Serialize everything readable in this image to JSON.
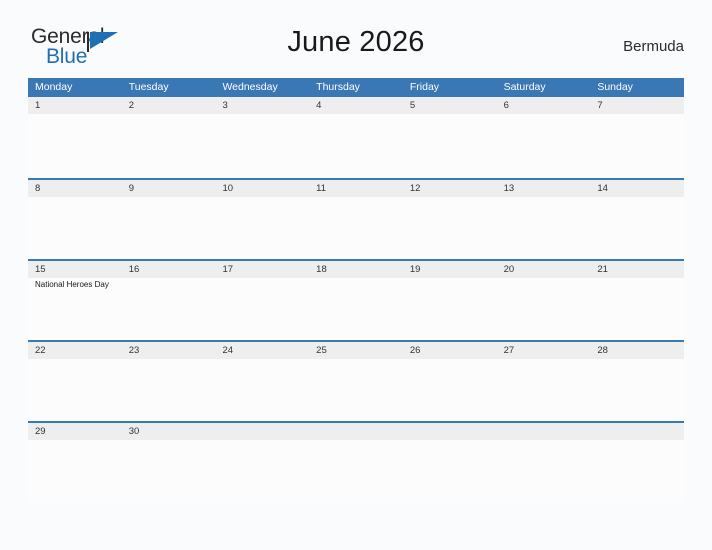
{
  "brand": {
    "name_part1": "General",
    "name_part2": "Blue",
    "flag_icon": "flag-icon",
    "color_primary": "#1f6fb5",
    "color_text": "#2b2b2b"
  },
  "header": {
    "title": "June 2026",
    "country": "Bermuda"
  },
  "theme": {
    "header_blue": "#3a77b5",
    "band_gray": "#eeeeee",
    "page_background": "#fafbfc",
    "cell_background": "#fcfcfd"
  },
  "calendar": {
    "weekdays": [
      "Monday",
      "Tuesday",
      "Wednesday",
      "Thursday",
      "Friday",
      "Saturday",
      "Sunday"
    ],
    "weeks": [
      {
        "days": [
          {
            "date": "1",
            "events": []
          },
          {
            "date": "2",
            "events": []
          },
          {
            "date": "3",
            "events": []
          },
          {
            "date": "4",
            "events": []
          },
          {
            "date": "5",
            "events": []
          },
          {
            "date": "6",
            "events": []
          },
          {
            "date": "7",
            "events": []
          }
        ]
      },
      {
        "days": [
          {
            "date": "8",
            "events": []
          },
          {
            "date": "9",
            "events": []
          },
          {
            "date": "10",
            "events": []
          },
          {
            "date": "11",
            "events": []
          },
          {
            "date": "12",
            "events": []
          },
          {
            "date": "13",
            "events": []
          },
          {
            "date": "14",
            "events": []
          }
        ]
      },
      {
        "days": [
          {
            "date": "15",
            "events": [
              "National Heroes Day"
            ]
          },
          {
            "date": "16",
            "events": []
          },
          {
            "date": "17",
            "events": []
          },
          {
            "date": "18",
            "events": []
          },
          {
            "date": "19",
            "events": []
          },
          {
            "date": "20",
            "events": []
          },
          {
            "date": "21",
            "events": []
          }
        ]
      },
      {
        "days": [
          {
            "date": "22",
            "events": []
          },
          {
            "date": "23",
            "events": []
          },
          {
            "date": "24",
            "events": []
          },
          {
            "date": "25",
            "events": []
          },
          {
            "date": "26",
            "events": []
          },
          {
            "date": "27",
            "events": []
          },
          {
            "date": "28",
            "events": []
          }
        ]
      },
      {
        "days": [
          {
            "date": "29",
            "events": []
          },
          {
            "date": "30",
            "events": []
          },
          {
            "date": "",
            "events": []
          },
          {
            "date": "",
            "events": []
          },
          {
            "date": "",
            "events": []
          },
          {
            "date": "",
            "events": []
          },
          {
            "date": "",
            "events": []
          }
        ]
      }
    ]
  }
}
